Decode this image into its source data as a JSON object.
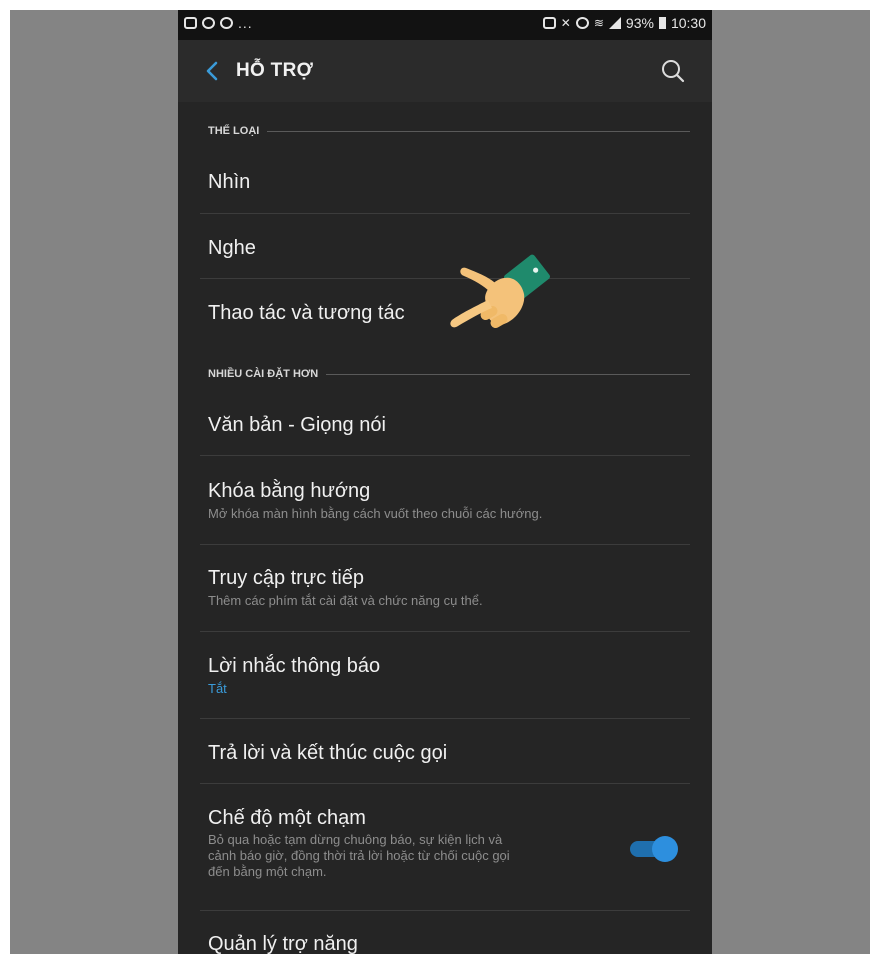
{
  "status_bar": {
    "left_extra": "...",
    "battery_percent": "93%",
    "time": "10:30"
  },
  "appbar": {
    "title": "HỖ TRỢ"
  },
  "sections": [
    {
      "header": "THỂ LOẠI"
    },
    {
      "header": "NHIỀU CÀI ĐẶT HƠN"
    }
  ],
  "items": [
    {
      "title": "Nhìn"
    },
    {
      "title": "Nghe"
    },
    {
      "title": "Thao tác và tương tác"
    },
    {
      "title": "Văn bản - Giọng nói"
    },
    {
      "title": "Khóa bằng hướng",
      "subtitle": "Mở khóa màn hình bằng cách vuốt theo chuỗi các hướng."
    },
    {
      "title": "Truy cập trực tiếp",
      "subtitle": "Thêm các phím tắt cài đặt và chức năng cụ thể."
    },
    {
      "title": "Lời nhắc thông báo",
      "subtitle": "Tắt"
    },
    {
      "title": "Trả lời và kết thúc cuộc gọi"
    },
    {
      "title": "Chế độ một chạm",
      "subtitle_lines": [
        "Bỏ qua hoặc tạm dừng chuông báo, sự kiện lịch và",
        "cảnh báo giờ, đồng thời trả lời hoặc từ chối cuộc gọi",
        "đến bằng một chạm."
      ],
      "toggle_on": true
    },
    {
      "title": "Quản lý trợ năng"
    }
  ],
  "colors": {
    "background": "#252525",
    "appbar": "#2b2b2b",
    "accent": "#2d8fde",
    "status_link": "#3a9bd9"
  },
  "icons": [
    "back-arrow-icon",
    "search-icon",
    "pointing-hand-icon"
  ]
}
